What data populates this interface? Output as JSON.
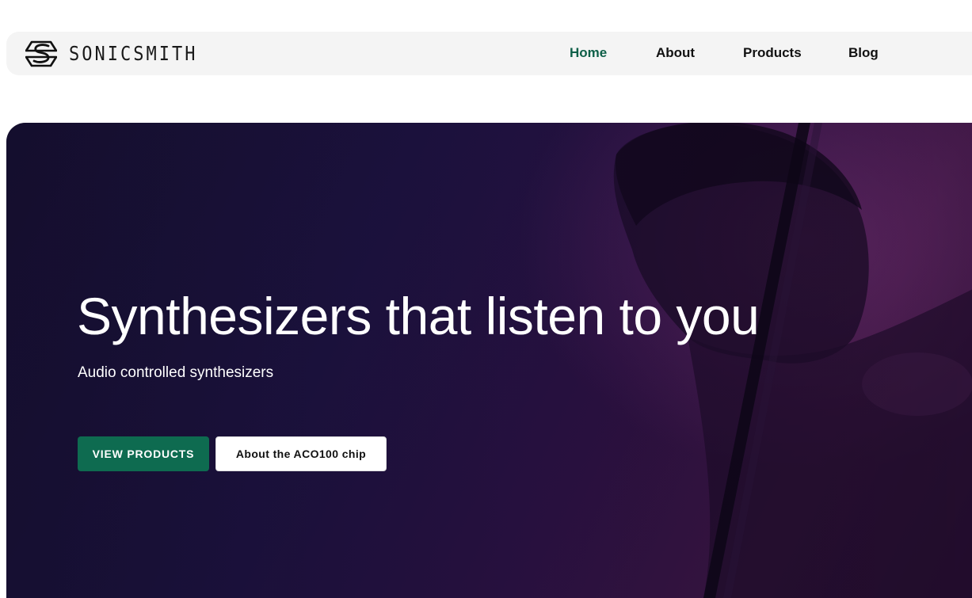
{
  "header": {
    "brand": "SONICSMITH",
    "nav": [
      {
        "label": "Home",
        "active": true
      },
      {
        "label": "About",
        "active": false
      },
      {
        "label": "Products",
        "active": false
      },
      {
        "label": "Blog",
        "active": false
      }
    ]
  },
  "hero": {
    "title": "Synthesizers that listen to you",
    "subtitle": "Audio controlled synthesizers",
    "primary_button": "VIEW PRODUCTS",
    "secondary_button": "About the ACO100 chip",
    "background_image": "musician-playing-double-bass-photo"
  },
  "colors": {
    "accent": "#0e5f48",
    "primary_button_bg": "#0e6b50",
    "hero_dark": "#16102f",
    "hero_purple": "#3a1541",
    "navbar_bg": "#f4f4f4"
  },
  "icons": {
    "logo": "sonicsmith-logo-icon"
  }
}
